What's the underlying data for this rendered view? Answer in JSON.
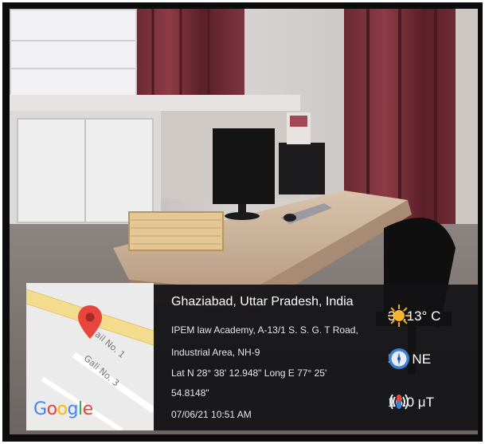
{
  "location": {
    "city": "Ghaziabad, Uttar Pradesh, India",
    "address_line_1": "IPEM law Academy, A-13/1 S. S. G. T Road,",
    "address_line_2": "Industrial Area, NH-9",
    "coords_line_1": "Lat N 28° 38' 12.948\" Long E 77° 25'",
    "coords_line_2": "54.8148\"",
    "timestamp": "07/06/21 10:51 AM"
  },
  "map": {
    "road_label_1": "ail No. 1",
    "road_label_2": "Gali No. 3",
    "logo": {
      "letters": [
        "G",
        "o",
        "o",
        "g",
        "l",
        "e"
      ],
      "colors": [
        "#4285F4",
        "#EA4335",
        "#FBBC05",
        "#4285F4",
        "#34A853",
        "#EA4335"
      ]
    },
    "pin_color": "#e8453c",
    "road_color": "#f4dc8f"
  },
  "stats": {
    "temperature": "35.13° C",
    "wind": "58° NE",
    "magnetic": "16.0 μT"
  },
  "icons": [
    "sun-icon",
    "compass-icon",
    "magnetometer-icon",
    "map-pin-icon"
  ]
}
